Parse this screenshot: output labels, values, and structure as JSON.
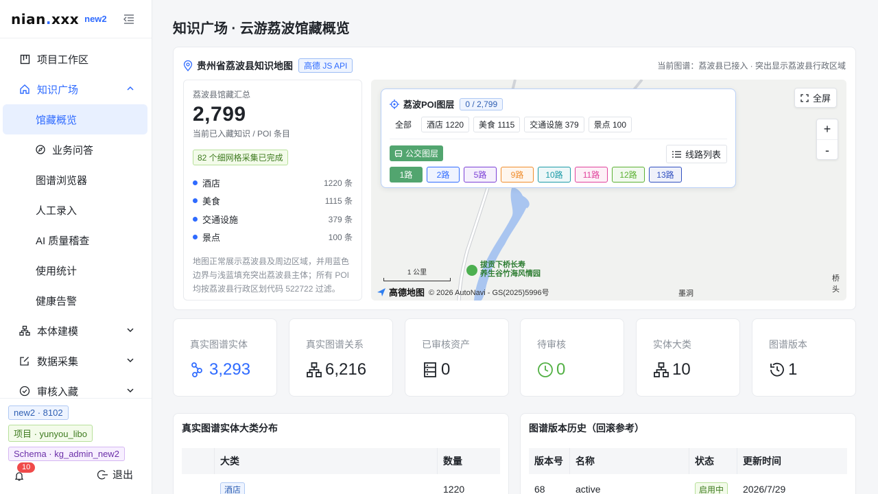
{
  "brand": {
    "name_a": "nian",
    "name_dot": ".",
    "name_b": "xxx",
    "env": "new2"
  },
  "nav": {
    "project_workspace": "项目工作区",
    "knowledge_plaza": "知识广场",
    "collection_overview": "馆藏概览",
    "business_qa": "业务问答",
    "graph_browser": "图谱浏览器",
    "manual_entry": "人工录入",
    "ai_quality": "AI 质量稽查",
    "usage_stats": "使用统计",
    "health_alerts": "健康告警",
    "ontology_modeling": "本体建模",
    "data_collection": "数据采集",
    "review_archive": "审核入藏"
  },
  "footer": {
    "tag_env": "new2 · 8102",
    "tag_project": "项目 · yunyou_libo",
    "tag_schema": "Schema · kg_admin_new2",
    "bell_count": "10",
    "logout": "退出"
  },
  "page": {
    "title": "知识广场 · 云游荔波馆藏概览"
  },
  "map_card": {
    "title": "贵州省荔波县知识地图",
    "api_badge": "高德 JS API",
    "status": "当前图谱：荔波县已接入 · 突出显示荔波县行政区域"
  },
  "summary": {
    "caption": "荔波县馆藏汇总",
    "total": "2,799",
    "subtitle": "当前已入藏知识 / POI 条目",
    "grid_done": "82 个细网格采集已完成",
    "categories": [
      {
        "name": "酒店",
        "value": "1220 条"
      },
      {
        "name": "美食",
        "value": "1115 条"
      },
      {
        "name": "交通设施",
        "value": "379 条"
      },
      {
        "name": "景点",
        "value": "100 条"
      }
    ],
    "note": "地图正常展示荔波县及周边区域，并用蓝色边界与浅蓝填充突出荔波县主体；所有 POI 均按荔波县行政区划代码 522722 过滤。"
  },
  "poi_panel": {
    "title": "荔波POI图层",
    "count": "0 / 2,799",
    "filters": [
      "全部",
      "酒店 1220",
      "美食 1115",
      "交通设施 379",
      "景点 100"
    ],
    "bus_layer": "公交图层",
    "route_list": "线路列表",
    "routes": [
      {
        "label": "1路",
        "color": "#52a56f"
      },
      {
        "label": "2路",
        "color": "#2f6bff"
      },
      {
        "label": "5路",
        "color": "#7b3fd6"
      },
      {
        "label": "9路",
        "color": "#f08c2a"
      },
      {
        "label": "10路",
        "color": "#1a9aa6"
      },
      {
        "label": "11路",
        "color": "#e0409b"
      },
      {
        "label": "12路",
        "color": "#5ab030"
      },
      {
        "label": "13路",
        "color": "#2f4fc0"
      }
    ]
  },
  "map": {
    "fullscreen": "全屏",
    "zoom_in": "+",
    "zoom_out": "-",
    "scale": "1 公里",
    "copyright": "© 2026 AutoNavi - GS(2025)5996号",
    "logo": "高德地图",
    "poi_line1": "拔贡下桥长寿",
    "poi_line2": "养生谷竹海风情园",
    "label_momo": "墨洞",
    "label_qiaotou": "桥头"
  },
  "stats": [
    {
      "label": "真实图谱实体",
      "value": "3,293",
      "color": "#2f6bff",
      "icon": "graph-nodes-icon"
    },
    {
      "label": "真实图谱关系",
      "value": "6,216",
      "color": "#1f2329",
      "icon": "hierarchy-icon"
    },
    {
      "label": "已审核资产",
      "value": "0",
      "color": "#1f2329",
      "icon": "server-icon"
    },
    {
      "label": "待审核",
      "value": "0",
      "color": "#52b044",
      "icon": "clock-icon"
    },
    {
      "label": "实体大类",
      "value": "10",
      "color": "#1f2329",
      "icon": "hierarchy-icon"
    },
    {
      "label": "图谱版本",
      "value": "1",
      "color": "#1f2329",
      "icon": "history-icon"
    }
  ],
  "entity_table": {
    "title": "真实图谱实体大类分布",
    "headers": [
      "大类",
      "数量"
    ],
    "rows": [
      {
        "category": "酒店",
        "count": "1220"
      }
    ]
  },
  "version_table": {
    "title": "图谱版本历史（回滚参考）",
    "headers": [
      "版本号",
      "名称",
      "状态",
      "更新时间"
    ],
    "rows": [
      {
        "version": "68",
        "name": "active",
        "status": "启用中",
        "updated": "2026/7/29"
      }
    ]
  }
}
